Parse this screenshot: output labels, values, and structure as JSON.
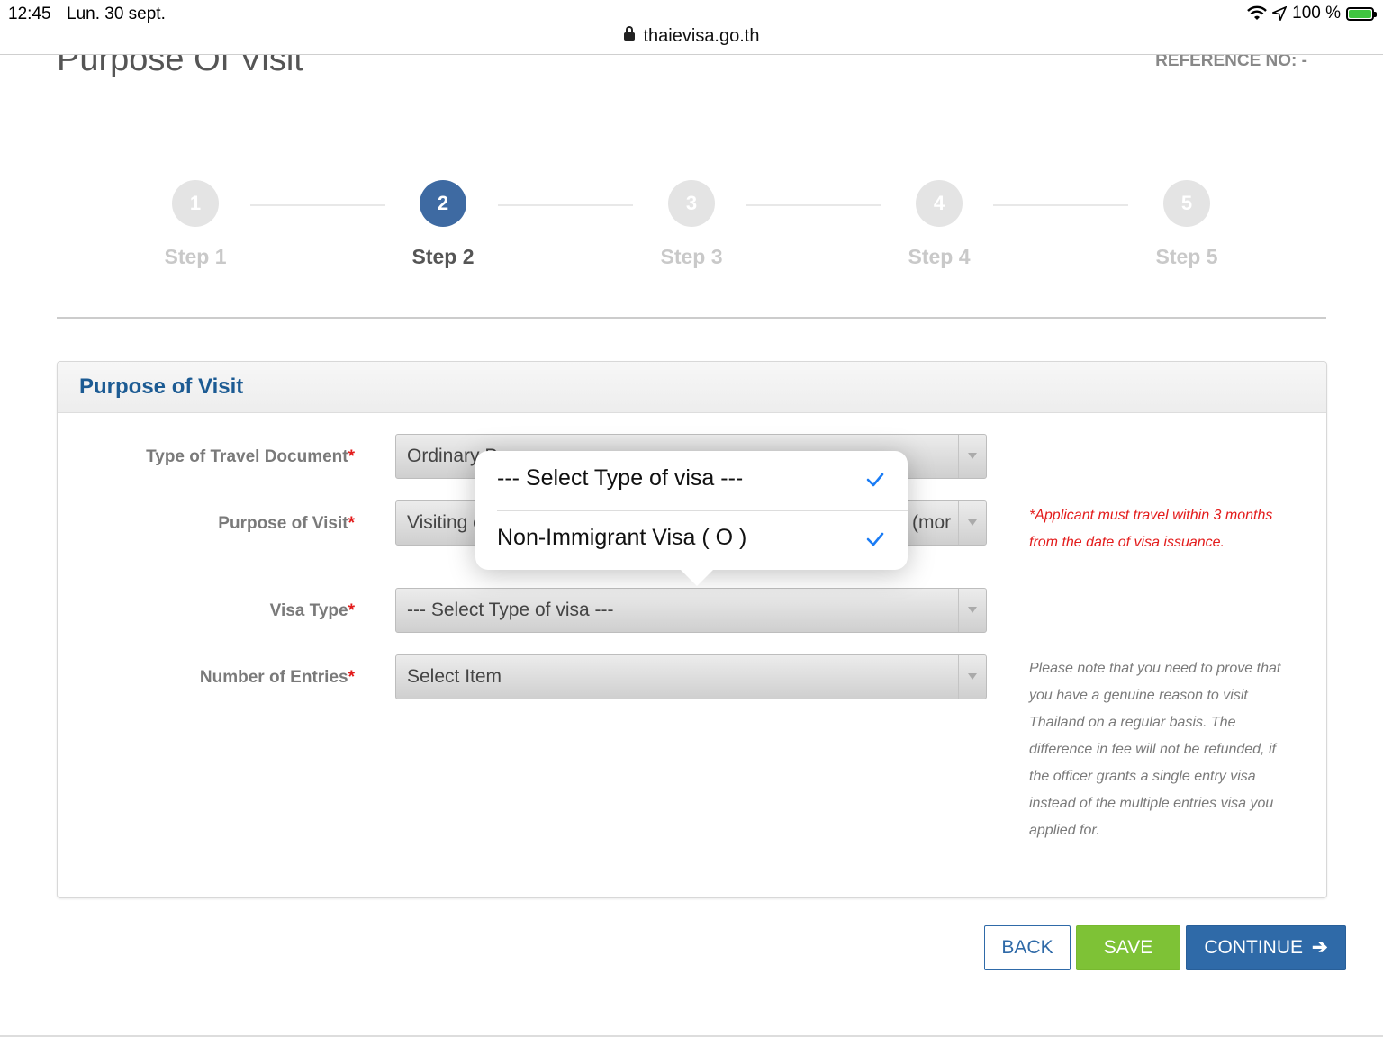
{
  "statusbar": {
    "time": "12:45",
    "date": "Lun. 30 sept.",
    "url": "thaievisa.go.th",
    "battery": "100 %"
  },
  "header": {
    "title": "Purpose Of Visit",
    "reference": "REFERENCE NO: -"
  },
  "steps": [
    {
      "num": "1",
      "label": "Step 1"
    },
    {
      "num": "2",
      "label": "Step 2"
    },
    {
      "num": "3",
      "label": "Step 3"
    },
    {
      "num": "4",
      "label": "Step 4"
    },
    {
      "num": "5",
      "label": "Step 5"
    }
  ],
  "panel": {
    "title": "Purpose of Visit",
    "fields": {
      "travel_doc": {
        "label": "Type of Travel Document",
        "value": "Ordinary P"
      },
      "purpose": {
        "label": "Purpose of Visit",
        "value": "Visiting c",
        "tail": "(mor"
      },
      "visa_type": {
        "label": "Visa Type",
        "value": "--- Select Type of visa ---"
      },
      "entries": {
        "label": "Number of Entries",
        "value": "Select Item"
      }
    },
    "required_mark": "*",
    "note_red": "*Applicant must travel within 3 months from the date of visa issuance.",
    "note_grey": "Please note that you need to prove that you have a genuine reason to visit Thailand on a regular basis. The difference in fee will not be refunded, if the officer grants a single entry visa instead of the multiple entries visa you applied for."
  },
  "popover": {
    "options": [
      "--- Select Type of visa ---",
      "Non-Immigrant Visa ( O )"
    ]
  },
  "buttons": {
    "back": "BACK",
    "save": "SAVE",
    "continue": "CONTINUE"
  },
  "colors": {
    "accent": "#2f6aa8",
    "save": "#7ec236",
    "required": "#e31b1b",
    "active_step": "#3e6aa2"
  }
}
